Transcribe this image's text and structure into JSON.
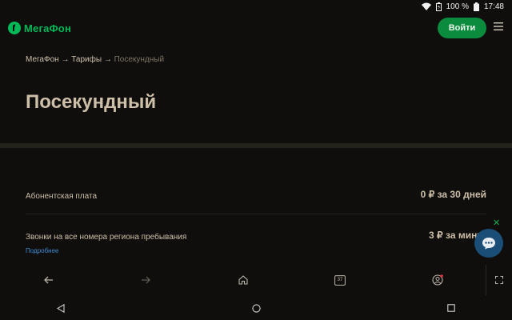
{
  "status_bar": {
    "battery_text": "100 %",
    "time": "17:48"
  },
  "header": {
    "logo_text": "МегаФон",
    "login_label": "Войти"
  },
  "breadcrumb": {
    "item1": "МегаФон",
    "sep1": "→",
    "item2": "Тарифы",
    "sep2": "→",
    "current": "Посекундный"
  },
  "page": {
    "title": "Посекундный"
  },
  "rows": [
    {
      "label": "Абонентская плата",
      "value": "0 ₽  за 30 дней"
    },
    {
      "label": "Звонки на все номера региона пребывания",
      "value": "3 ₽ за минуту",
      "link": "Подробнее"
    }
  ],
  "widget": {
    "close_text": "✕"
  },
  "browser_bar": {
    "tabs_count": "37"
  },
  "colors": {
    "brand": "#00b956",
    "button_bg": "#0b8b3e",
    "link": "#3d8ad0",
    "chat": "#1b4e76"
  }
}
